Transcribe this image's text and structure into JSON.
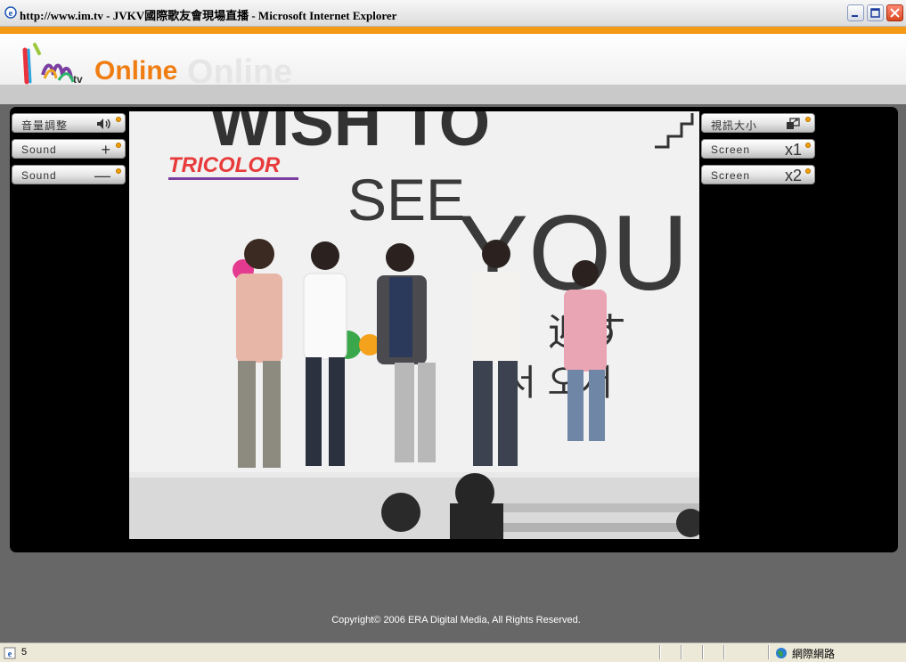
{
  "window": {
    "title": "http://www.im.tv - JVKV國際歌友會現場直播 - Microsoft Internet Explorer"
  },
  "logo": {
    "brand": "Online",
    "ghost": "Online",
    "sub": "tv"
  },
  "controls": {
    "left": [
      {
        "label": "音量調整",
        "symbol": "◀))"
      },
      {
        "label": "Sound",
        "symbol": "+"
      },
      {
        "label": "Sound",
        "symbol": "—"
      }
    ],
    "right": [
      {
        "label": "視訊大小",
        "symbol": "⤢"
      },
      {
        "label": "Screen",
        "symbol": "x1"
      },
      {
        "label": "Screen",
        "symbol": "x2"
      }
    ]
  },
  "video": {
    "backdrop_lines": [
      "WISH TO",
      "SEE",
      "YOU"
    ],
    "overlay_logo": "TRICOLOR",
    "side_text": [
      "迎す",
      "서 오서"
    ]
  },
  "footer": {
    "copyright": "Copyright© 2006 ERA Digital Media, All Rights Reserved."
  },
  "status": {
    "left": "5",
    "zone": "網際網路"
  },
  "colors": {
    "accent": "#f49a17",
    "logo_orange": "#f07d12"
  }
}
